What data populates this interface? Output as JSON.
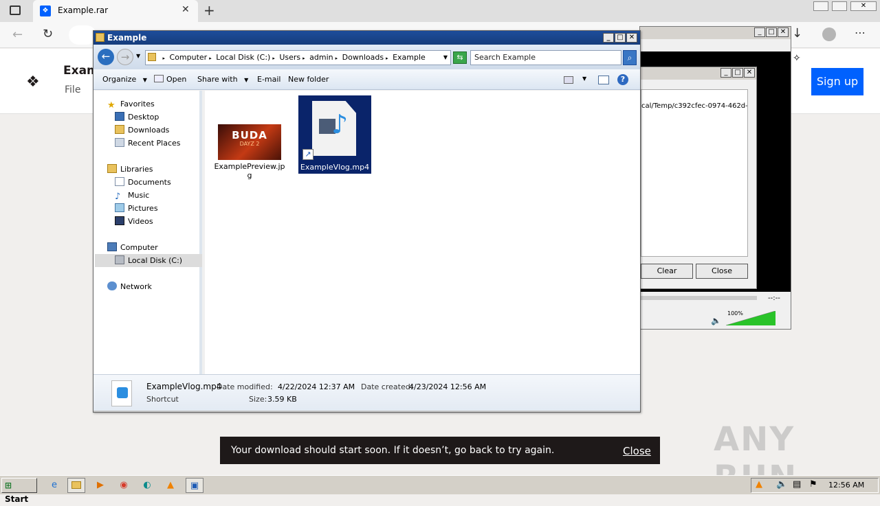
{
  "browser": {
    "tab_title": "Example.rar",
    "new_tab_icon": "plus-icon",
    "page_title_partial": "Exam",
    "page_subtitle": "File",
    "signup_label": "Sign up"
  },
  "explorer": {
    "title": "Example",
    "breadcrumb": [
      "Computer",
      "Local Disk (C:)",
      "Users",
      "admin",
      "Downloads",
      "Example"
    ],
    "search_placeholder": "Search Example",
    "toolbar": {
      "organize": "Organize",
      "open": "Open",
      "share_with": "Share with",
      "email": "E-mail",
      "new_folder": "New folder"
    },
    "nav": {
      "favorites": "Favorites",
      "desktop": "Desktop",
      "downloads": "Downloads",
      "recent_places": "Recent Places",
      "libraries": "Libraries",
      "documents": "Documents",
      "music": "Music",
      "pictures": "Pictures",
      "videos": "Videos",
      "computer": "Computer",
      "local_disk": "Local Disk (C:)",
      "network": "Network"
    },
    "files": [
      {
        "name": "ExamplePreview.jpg",
        "thumb_text_1": "BUDA",
        "thumb_text_2": "DAYZ 2"
      },
      {
        "name": "ExampleVlog.mp4",
        "selected": true
      }
    ],
    "details": {
      "name": "ExampleVlog.mp4",
      "type": "Shortcut",
      "modified_label": "Date modified:",
      "modified_value": "4/22/2024 12:37 AM",
      "created_label": "Date created:",
      "created_value": "4/23/2024 12:56 AM",
      "size_label": "Size:",
      "size_value": "3.59 KB"
    }
  },
  "player": {
    "path_text": "cal/Temp/c392cfec-0974-462d-",
    "clear_label": "Clear",
    "close_label": "Close",
    "time_text": "--:--",
    "volume_text": "100%",
    "volume_level": 1.0
  },
  "toast": {
    "message": "Your download should start soon. If it doesn’t, go back to try again.",
    "close_label": "Close"
  },
  "taskbar": {
    "start_label": "Start",
    "clock": "12:56 AM"
  },
  "watermark": "ANY RUN",
  "colors": {
    "signup_bg": "#0061fe",
    "title_bar": "#1d4d9b",
    "selection": "#0a246a",
    "toast_bg": "#1e1919"
  }
}
